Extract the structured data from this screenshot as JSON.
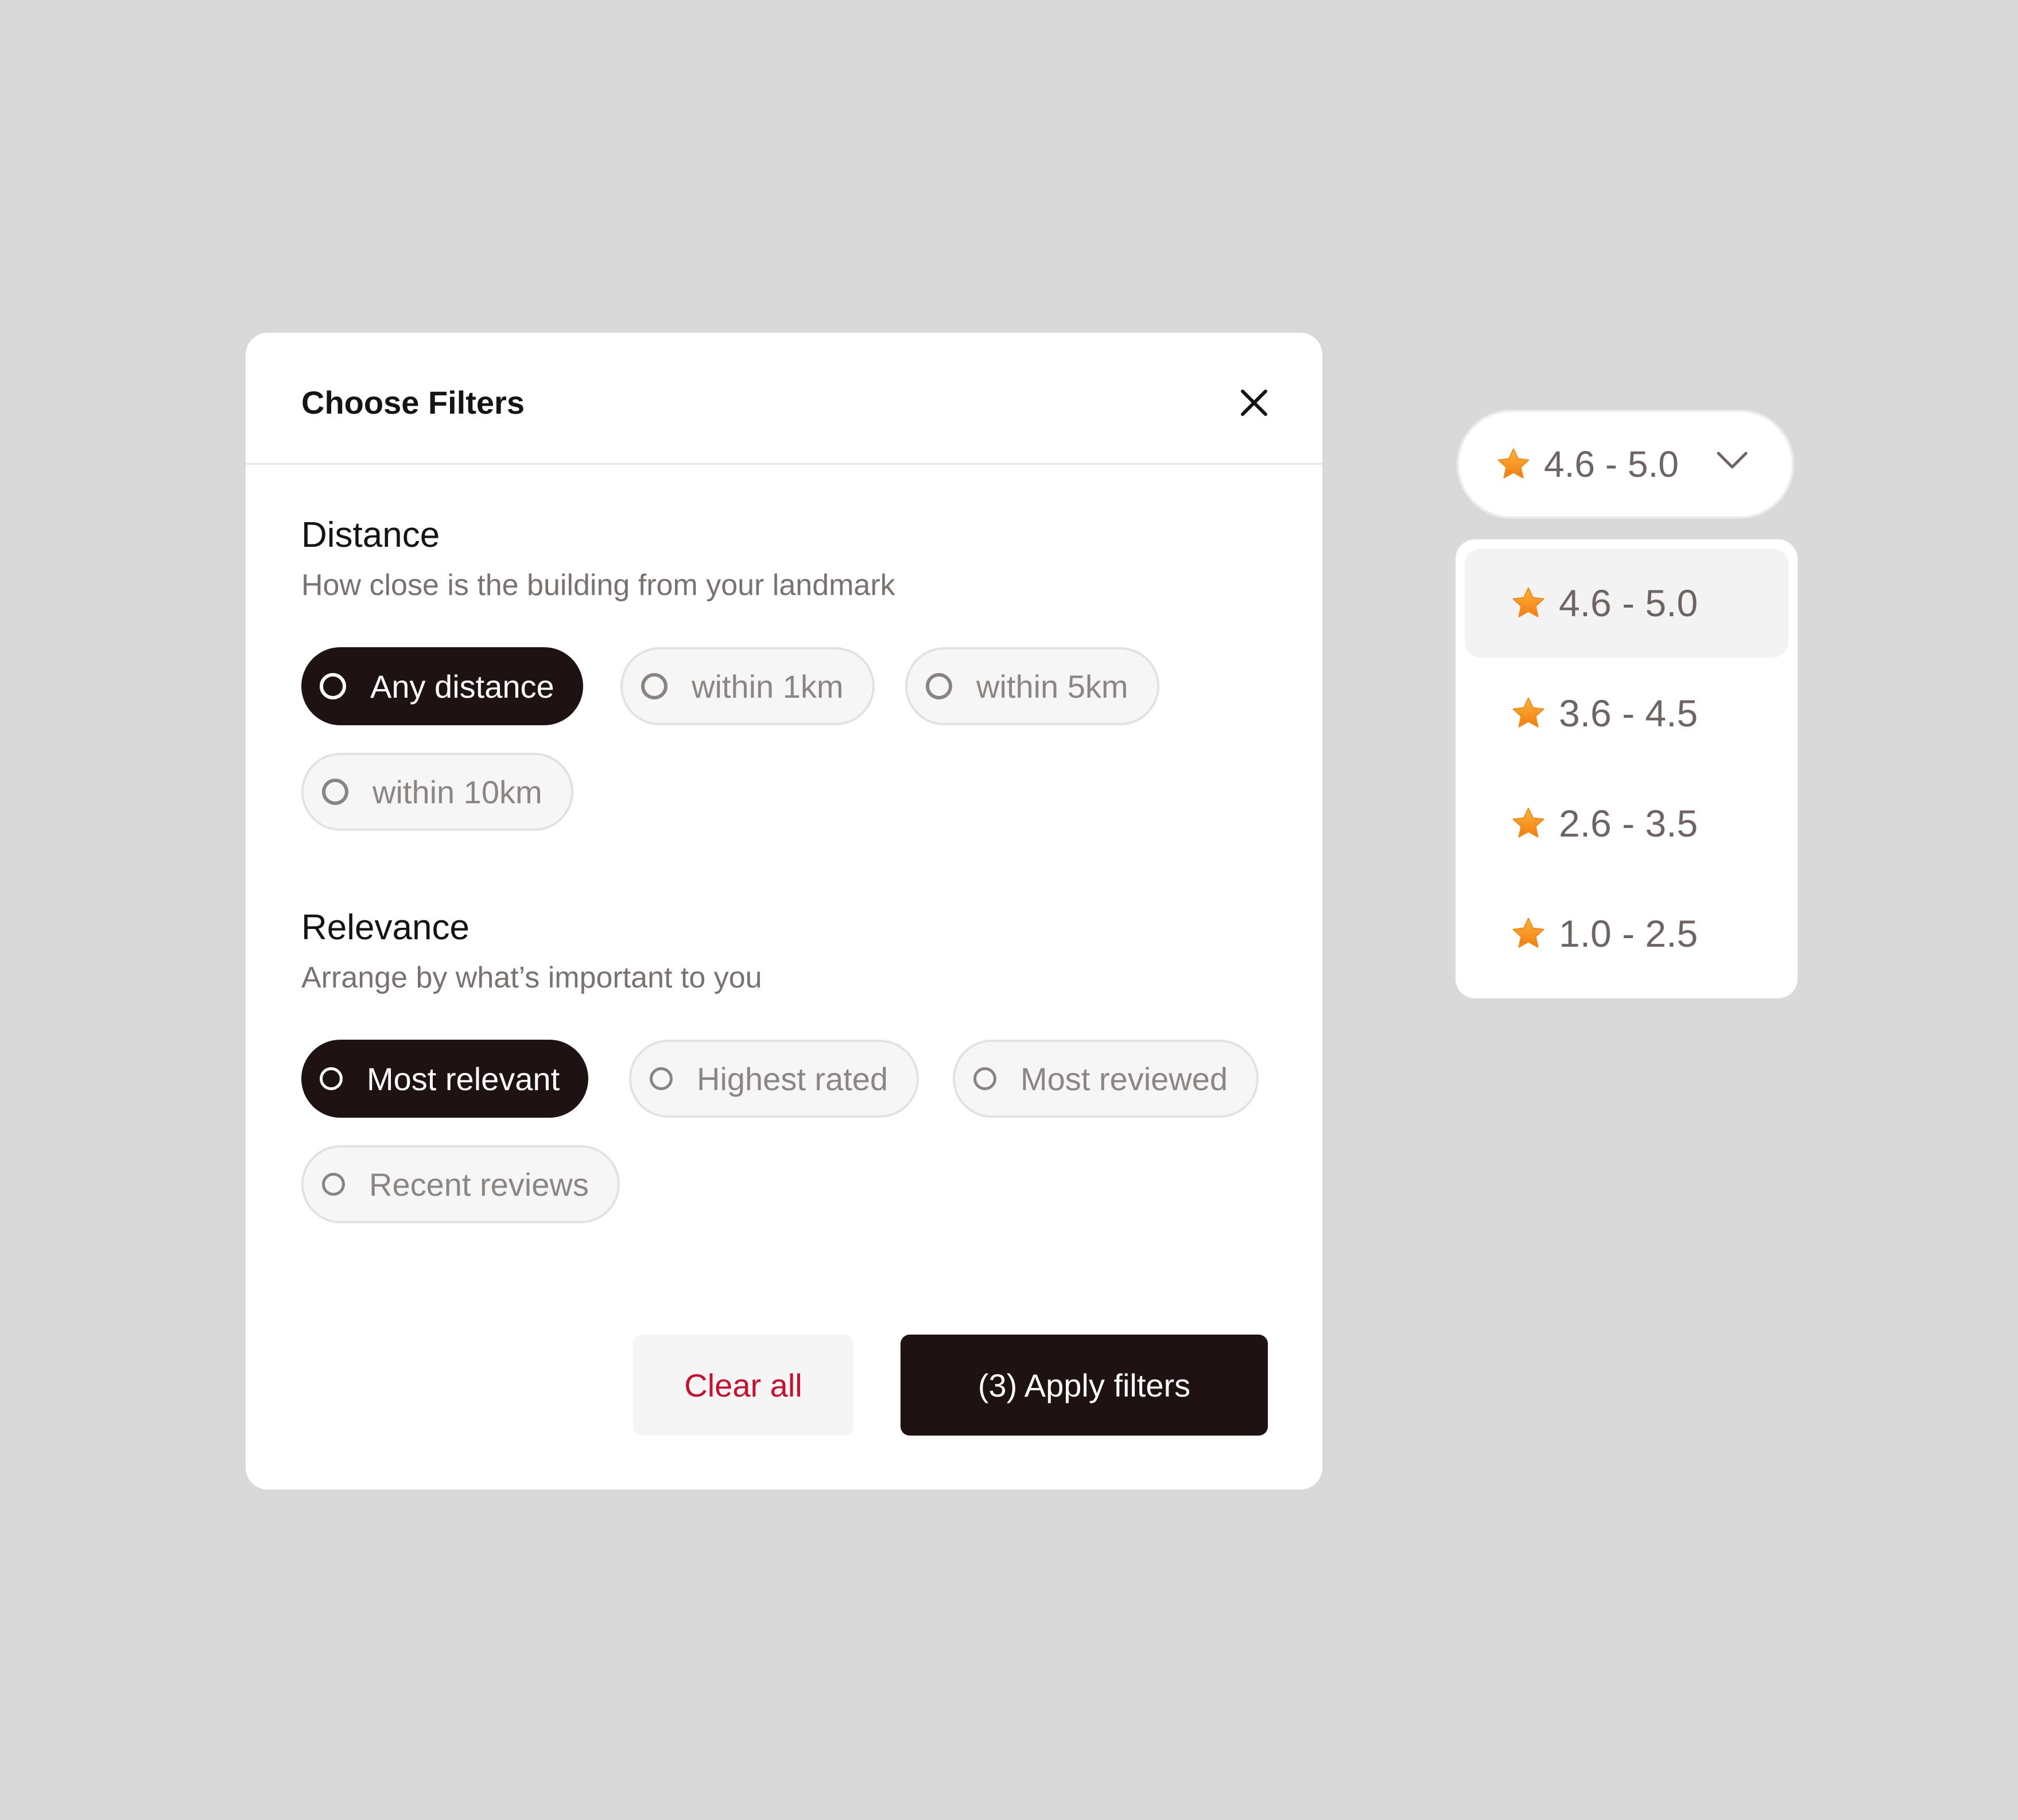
{
  "modal": {
    "title": "Choose Filters",
    "close_icon": "close-icon"
  },
  "distance": {
    "title": "Distance",
    "subtitle": "How close is the building from your landmark",
    "options": [
      "Any distance",
      "within 1km",
      "within 5km",
      "within 10km"
    ],
    "selected": "Any distance"
  },
  "relevance": {
    "title": "Relevance",
    "subtitle": "Arrange by what’s important to you",
    "options": [
      "Most relevant",
      "Highest rated",
      "Most reviewed",
      "Recent reviews"
    ],
    "selected": "Most relevant"
  },
  "footer": {
    "clear_label": "Clear all",
    "apply_label": "(3) Apply filters"
  },
  "rating": {
    "current": "4.6 - 5.0",
    "icon": "star-icon",
    "options": [
      "4.6 - 5.0",
      "3.6 - 4.5",
      "2.6 - 3.5",
      "1.0 - 2.5"
    ],
    "selected": "4.6 - 5.0"
  },
  "colors": {
    "background": "#d9d9d9",
    "primary_dark": "#1e1213",
    "danger": "#c8102e",
    "star": "#f5a623"
  }
}
